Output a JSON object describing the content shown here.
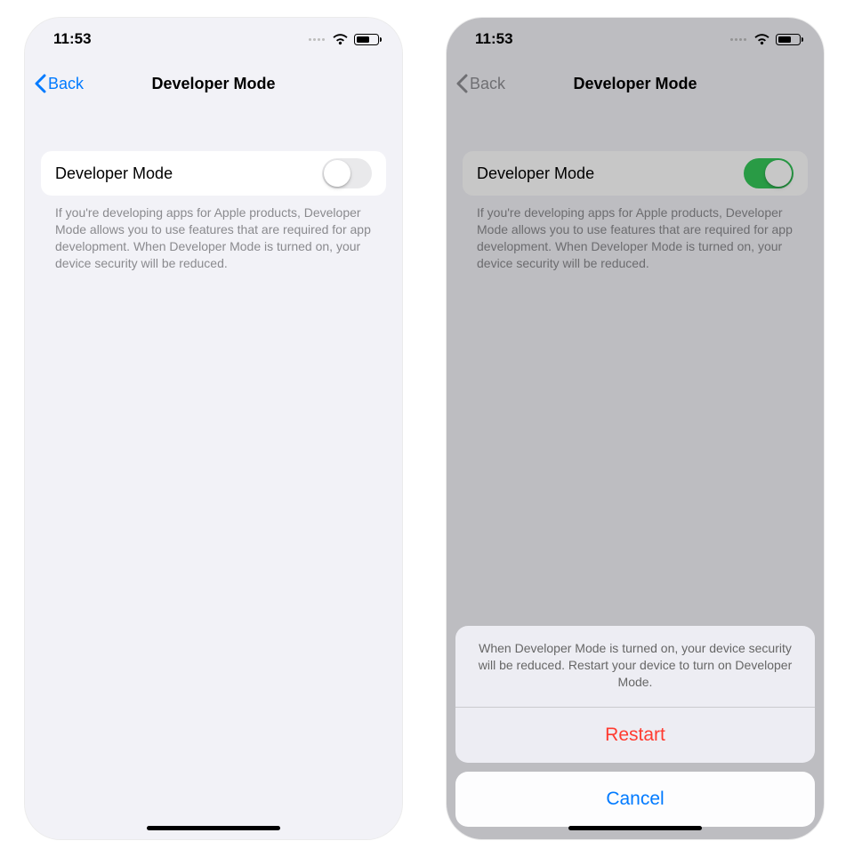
{
  "left": {
    "status": {
      "time": "11:53"
    },
    "nav": {
      "back_label": "Back",
      "title": "Developer Mode"
    },
    "row": {
      "label": "Developer Mode",
      "toggle_on": false
    },
    "footer": "If you're developing apps for Apple products, Developer Mode allows you to use features that are required for app development. When Developer Mode is turned on, your device security will be reduced."
  },
  "right": {
    "status": {
      "time": "11:53"
    },
    "nav": {
      "back_label": "Back",
      "title": "Developer Mode"
    },
    "row": {
      "label": "Developer Mode",
      "toggle_on": true
    },
    "footer": "If you're developing apps for Apple products, Developer Mode allows you to use features that are required for app development. When Developer Mode is turned on, your device security will be reduced.",
    "sheet": {
      "message": "When Developer Mode is turned on, your device security will be reduced. Restart your device to turn on Developer Mode.",
      "restart_label": "Restart",
      "cancel_label": "Cancel"
    }
  }
}
